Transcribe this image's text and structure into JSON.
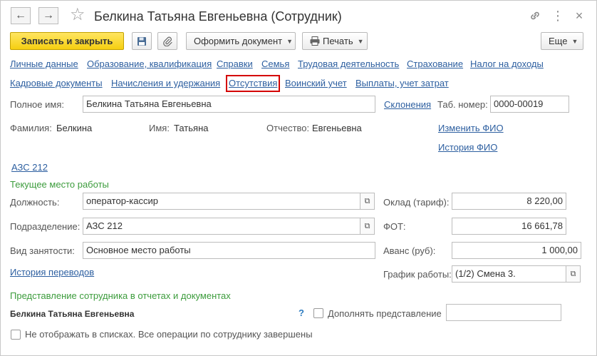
{
  "window": {
    "title": "Белкина Татьяна Евгеньевна (Сотрудник)",
    "back_icon": "←",
    "forward_icon": "→",
    "star_icon": "☆",
    "link_icon": "🔗",
    "more_icon": "⋮",
    "close_icon": "×"
  },
  "toolbar": {
    "save_close": "Записать и закрыть",
    "save_icon": "💾",
    "attach_icon": "📎",
    "issue_document": "Оформить документ",
    "print": "Печать",
    "print_icon": "🖶",
    "more": "Еще",
    "caret": "▼"
  },
  "nav_links": {
    "row1": [
      "Личные данные",
      "Образование, квалификация",
      "Справки",
      "Семья",
      "Трудовая деятельность",
      "Страхование",
      "Налог на доходы"
    ],
    "row2": [
      "Кадровые документы",
      "Начисления и удержания",
      "Отсутствия",
      "Воинский учет",
      "Выплаты, учет затрат"
    ]
  },
  "personal": {
    "full_name_label": "Полное имя:",
    "full_name": "Белкина Татьяна Евгеньевна",
    "declensions_link": "Склонения",
    "tab_number_label": "Таб. номер:",
    "tab_number": "0000-00019",
    "surname_label": "Фамилия:",
    "surname": "Белкина",
    "name_label": "Имя:",
    "name": "Татьяна",
    "patronymic_label": "Отчество:",
    "patronymic": "Евгеньевна",
    "change_fio_link": "Изменить ФИО",
    "fio_history_link": "История ФИО"
  },
  "organization_link": "АЗС 212",
  "current_job": {
    "section_title": "Текущее место работы",
    "position_label": "Должность:",
    "position": "оператор-кассир",
    "department_label": "Подразделение:",
    "department": "АЗС 212",
    "employment_type_label": "Вид занятости:",
    "employment_type": "Основное место работы",
    "transfer_history_link": "История переводов",
    "salary_label": "Оклад (тариф):",
    "salary": "8 220,00",
    "fot_label": "ФОТ:",
    "fot": "16 661,78",
    "advance_label": "Аванс (руб):",
    "advance": "1 000,00",
    "schedule_label": "График работы:",
    "schedule": "(1/2) Смена 3.",
    "pick_icon": "⧉"
  },
  "representation": {
    "section_title": "Представление сотрудника в отчетах и документах",
    "name": "Белкина Татьяна Евгеньевна",
    "help_icon": "?",
    "supplement_label": "Дополнять представление",
    "supplement_value": ""
  },
  "hide_in_lists_label": "Не отображать в списках. Все операции по сотруднику завершены"
}
